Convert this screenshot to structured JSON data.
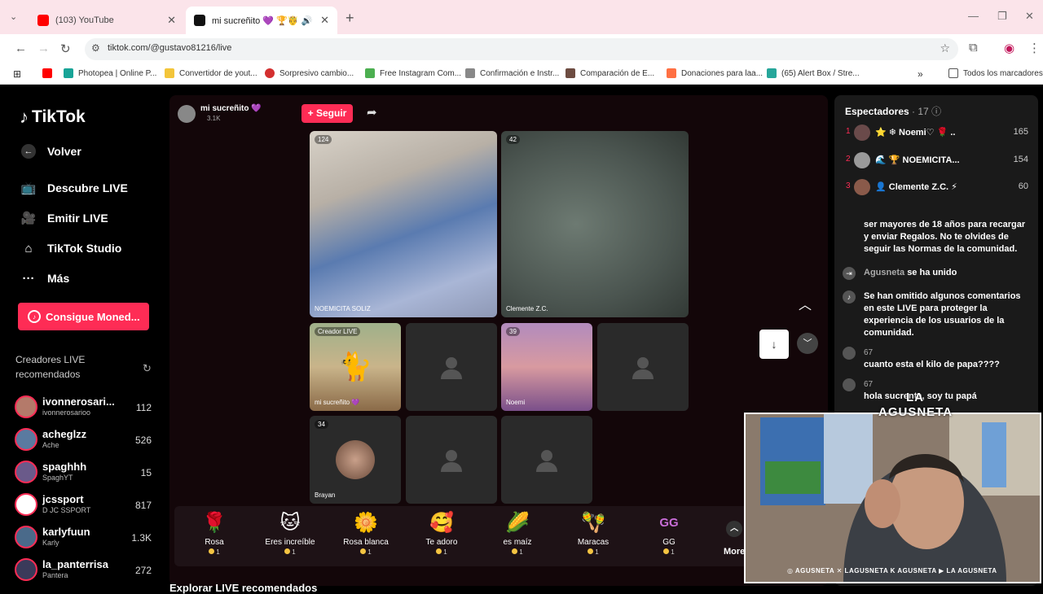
{
  "browser": {
    "tabs": [
      {
        "title": "(103) YouTube",
        "active": false,
        "close": "✕"
      },
      {
        "title": "mi sucreñito 💜 🏆🤴 🔊",
        "active": true,
        "close": "✕"
      }
    ],
    "new_tab": "+",
    "url": "tiktok.com/@gustavo81216/live",
    "bookmarks": [
      "Photopea | Online P...",
      "Convertidor de yout...",
      "Sorpresivo cambio...",
      "Free Instagram Com...",
      "Confirmación e Instr...",
      "Comparación de E...",
      "Donaciones para laa...",
      "(65) Alert Box / Stre..."
    ],
    "all_bookmarks": "Todos los marcadores"
  },
  "sidebar": {
    "logo": "TikTok",
    "back": "Volver",
    "nav": [
      "Descubre LIVE",
      "Emitir LIVE",
      "TikTok Studio",
      "Más"
    ],
    "coins_button": "Consigue Moned...",
    "recommended_title": "Creadores LIVE recomendados",
    "creators": [
      {
        "name": "ivonnerosari...",
        "sub": "ivonnerosarioo",
        "count": "112"
      },
      {
        "name": "acheglzz",
        "sub": "Ache",
        "count": "526"
      },
      {
        "name": "spaghhh",
        "sub": "SpaghYT",
        "count": "15"
      },
      {
        "name": "jcssport",
        "sub": "D JC SSPORT",
        "count": "817"
      },
      {
        "name": "karlyfuun",
        "sub": "Karly",
        "count": "1.3K"
      },
      {
        "name": "la_panterrisa",
        "sub": "Pantera",
        "count": "272"
      }
    ]
  },
  "stream": {
    "host_name": "mi sucreñito 💜",
    "host_likes": "3.1K",
    "follow_label": "+ Seguir",
    "tiles": [
      {
        "badge": "124",
        "label": "NOEMICITA SOLIZ"
      },
      {
        "badge": "42",
        "label": "Clemente Z.C."
      },
      {
        "badge": "Creador LIVE",
        "label": "mi sucreñito 💜"
      },
      {
        "badge": "39",
        "label": "Noemi"
      },
      {
        "badge": "34",
        "label": "Brayan"
      }
    ],
    "gifts": [
      {
        "icon": "🌹",
        "name": "Rosa",
        "cost": "1"
      },
      {
        "icon": "🐱",
        "name": "Eres increíble",
        "cost": "1"
      },
      {
        "icon": "🌼",
        "name": "Rosa blanca",
        "cost": "1"
      },
      {
        "icon": "🥰",
        "name": "Te adoro",
        "cost": "1"
      },
      {
        "icon": "🌽",
        "name": "es maíz",
        "cost": "1"
      },
      {
        "icon": "🪇",
        "name": "Maracas",
        "cost": "1"
      },
      {
        "icon": "GG",
        "name": "GG",
        "cost": "1"
      }
    ],
    "more_label": "More",
    "bottom_text": "Explorar LIVE recomendados"
  },
  "viewers": {
    "title": "Espectadores",
    "count": "· 17",
    "list": [
      {
        "rank": "1",
        "name": "⭐ ❄ Noemi♡ 🌹 ..",
        "score": "165"
      },
      {
        "rank": "2",
        "name": "🌊 🏆 NOEMICITA...",
        "score": "154"
      },
      {
        "rank": "3",
        "name": "👤 Clemente Z.C. ⚡",
        "score": "60"
      }
    ]
  },
  "chat": [
    {
      "type": "system",
      "user": "",
      "text": "ser mayores de 18 años para recargar y enviar Regalos. No te olvides de seguir las Normas de la comunidad."
    },
    {
      "type": "join",
      "user": "Agusneta",
      "text": "se ha unido"
    },
    {
      "type": "system",
      "user": "",
      "text": "Se han omitido algunos comentarios en este LIVE para proteger la experiencia de los usuarios de la comunidad."
    },
    {
      "type": "msg",
      "user": "67",
      "text": "cuanto esta el kilo de papa????"
    },
    {
      "type": "msg",
      "user": "67",
      "text": "hola sucrenta, soy tu papá"
    }
  ],
  "overlay": {
    "logo": "LA AGUSNETA",
    "social": "◎ AGUSNETA  ✕ LAGUSNETA  K AGUSNETA  ▶ LA AGUSNETA"
  },
  "colors": {
    "accent": "#fe2c55",
    "stream_bg": "#130609",
    "panel_bg": "#1a1a1a"
  }
}
